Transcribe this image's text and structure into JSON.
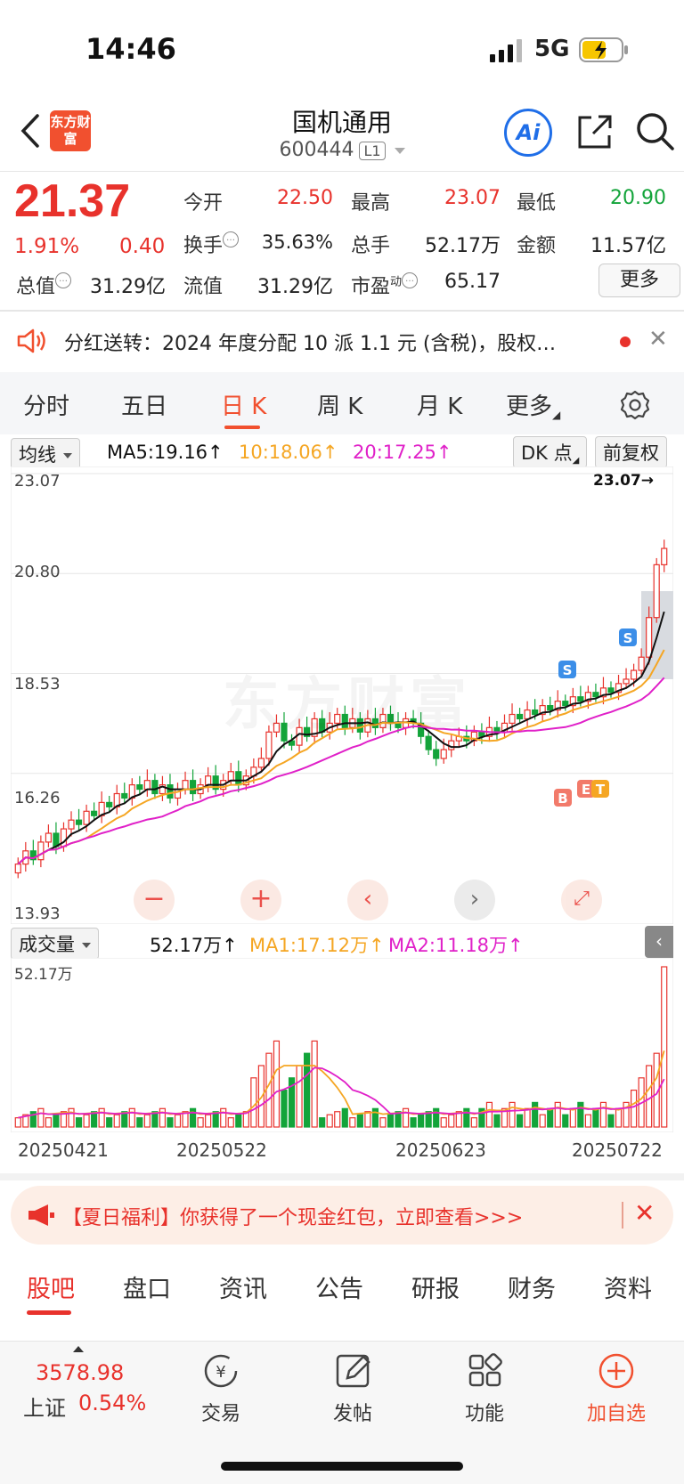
{
  "status": {
    "time": "14:46",
    "network": "5G"
  },
  "header": {
    "logo": "东方财富",
    "title": "国机通用",
    "code": "600444",
    "level": "L1",
    "ai_label": "Ai"
  },
  "quote": {
    "price": "21.37",
    "change_pct": "1.91%",
    "change": "0.40",
    "open_label": "今开",
    "open": "22.50",
    "high_label": "最高",
    "high": "23.07",
    "low_label": "最低",
    "low": "20.90",
    "turnover_label": "换手",
    "turnover": "35.63%",
    "volume_label": "总手",
    "volume": "52.17万",
    "amount_label": "金额",
    "amount": "11.57亿",
    "mktcap_label": "总值",
    "mktcap": "31.29亿",
    "float_label": "流值",
    "float": "31.29亿",
    "pe_label": "市盈",
    "pe_sup": "动",
    "pe": "65.17",
    "more": "更多"
  },
  "notice": {
    "text": "分红送转：2024 年度分配 10 派 1.1 元 (含税)，股权…"
  },
  "tabs": [
    "分时",
    "五日",
    "日 K",
    "周 K",
    "月 K",
    "更多"
  ],
  "chart": {
    "indicator": "均线",
    "ma5": "MA5:19.16↑",
    "ma10": "10:18.06↑",
    "ma20": "20:17.25↑",
    "dk": "DK 点",
    "adjust": "前复权",
    "watermark": "东方财富",
    "vol_indicator": "成交量",
    "vol_value": "52.17万↑",
    "vol_ma1": "MA1:17.12万↑",
    "vol_ma2": "MA2:11.18万↑",
    "vol_max": "52.17万",
    "colors": {
      "up": "#e8322c",
      "down": "#13a43a",
      "ma5": "#111111",
      "ma10": "#f5a623",
      "ma20": "#e020c8"
    }
  },
  "chart_data": {
    "type": "bar",
    "y_ticks": [
      "23.07",
      "20.80",
      "18.53",
      "16.26",
      "13.93"
    ],
    "ylim": [
      13.93,
      23.07
    ],
    "high_marker": "23.07",
    "x_ticks": [
      "20250421",
      "20250522",
      "20250623",
      "20250722"
    ],
    "signals": [
      "S",
      "S",
      "B",
      "E",
      "T"
    ],
    "close": [
      14.2,
      14.5,
      14.3,
      14.7,
      14.9,
      14.6,
      15.0,
      15.2,
      15.1,
      15.4,
      15.3,
      15.6,
      15.5,
      15.8,
      15.7,
      16.0,
      15.9,
      16.1,
      15.8,
      16.0,
      15.7,
      15.9,
      16.1,
      15.8,
      16.0,
      16.2,
      15.9,
      16.1,
      16.3,
      16.0,
      16.2,
      16.4,
      16.6,
      17.2,
      17.4,
      17.0,
      16.9,
      17.3,
      17.1,
      17.5,
      17.2,
      17.4,
      17.6,
      17.3,
      17.5,
      17.2,
      17.5,
      17.3,
      17.6,
      17.4,
      17.3,
      17.5,
      17.4,
      17.1,
      16.8,
      16.6,
      16.8,
      17.0,
      17.1,
      17.0,
      17.2,
      17.1,
      17.3,
      17.2,
      17.4,
      17.6,
      17.5,
      17.7,
      17.6,
      17.8,
      17.7,
      17.9,
      17.8,
      18.0,
      17.9,
      18.1,
      18.0,
      18.2,
      18.1,
      18.3,
      18.4,
      18.6,
      18.9,
      19.8,
      21.0,
      21.37
    ],
    "volume_max": 52.17
  },
  "banner": {
    "text": "【夏日福利】你获得了一个现金红包，立即查看>>>"
  },
  "sections": [
    "股吧",
    "盘口",
    "资讯",
    "公告",
    "研报",
    "财务",
    "资料"
  ],
  "index": {
    "value": "3578.98",
    "name": "上证",
    "change": "0.54%"
  },
  "bottom": [
    "交易",
    "发帖",
    "功能",
    "加自选"
  ]
}
